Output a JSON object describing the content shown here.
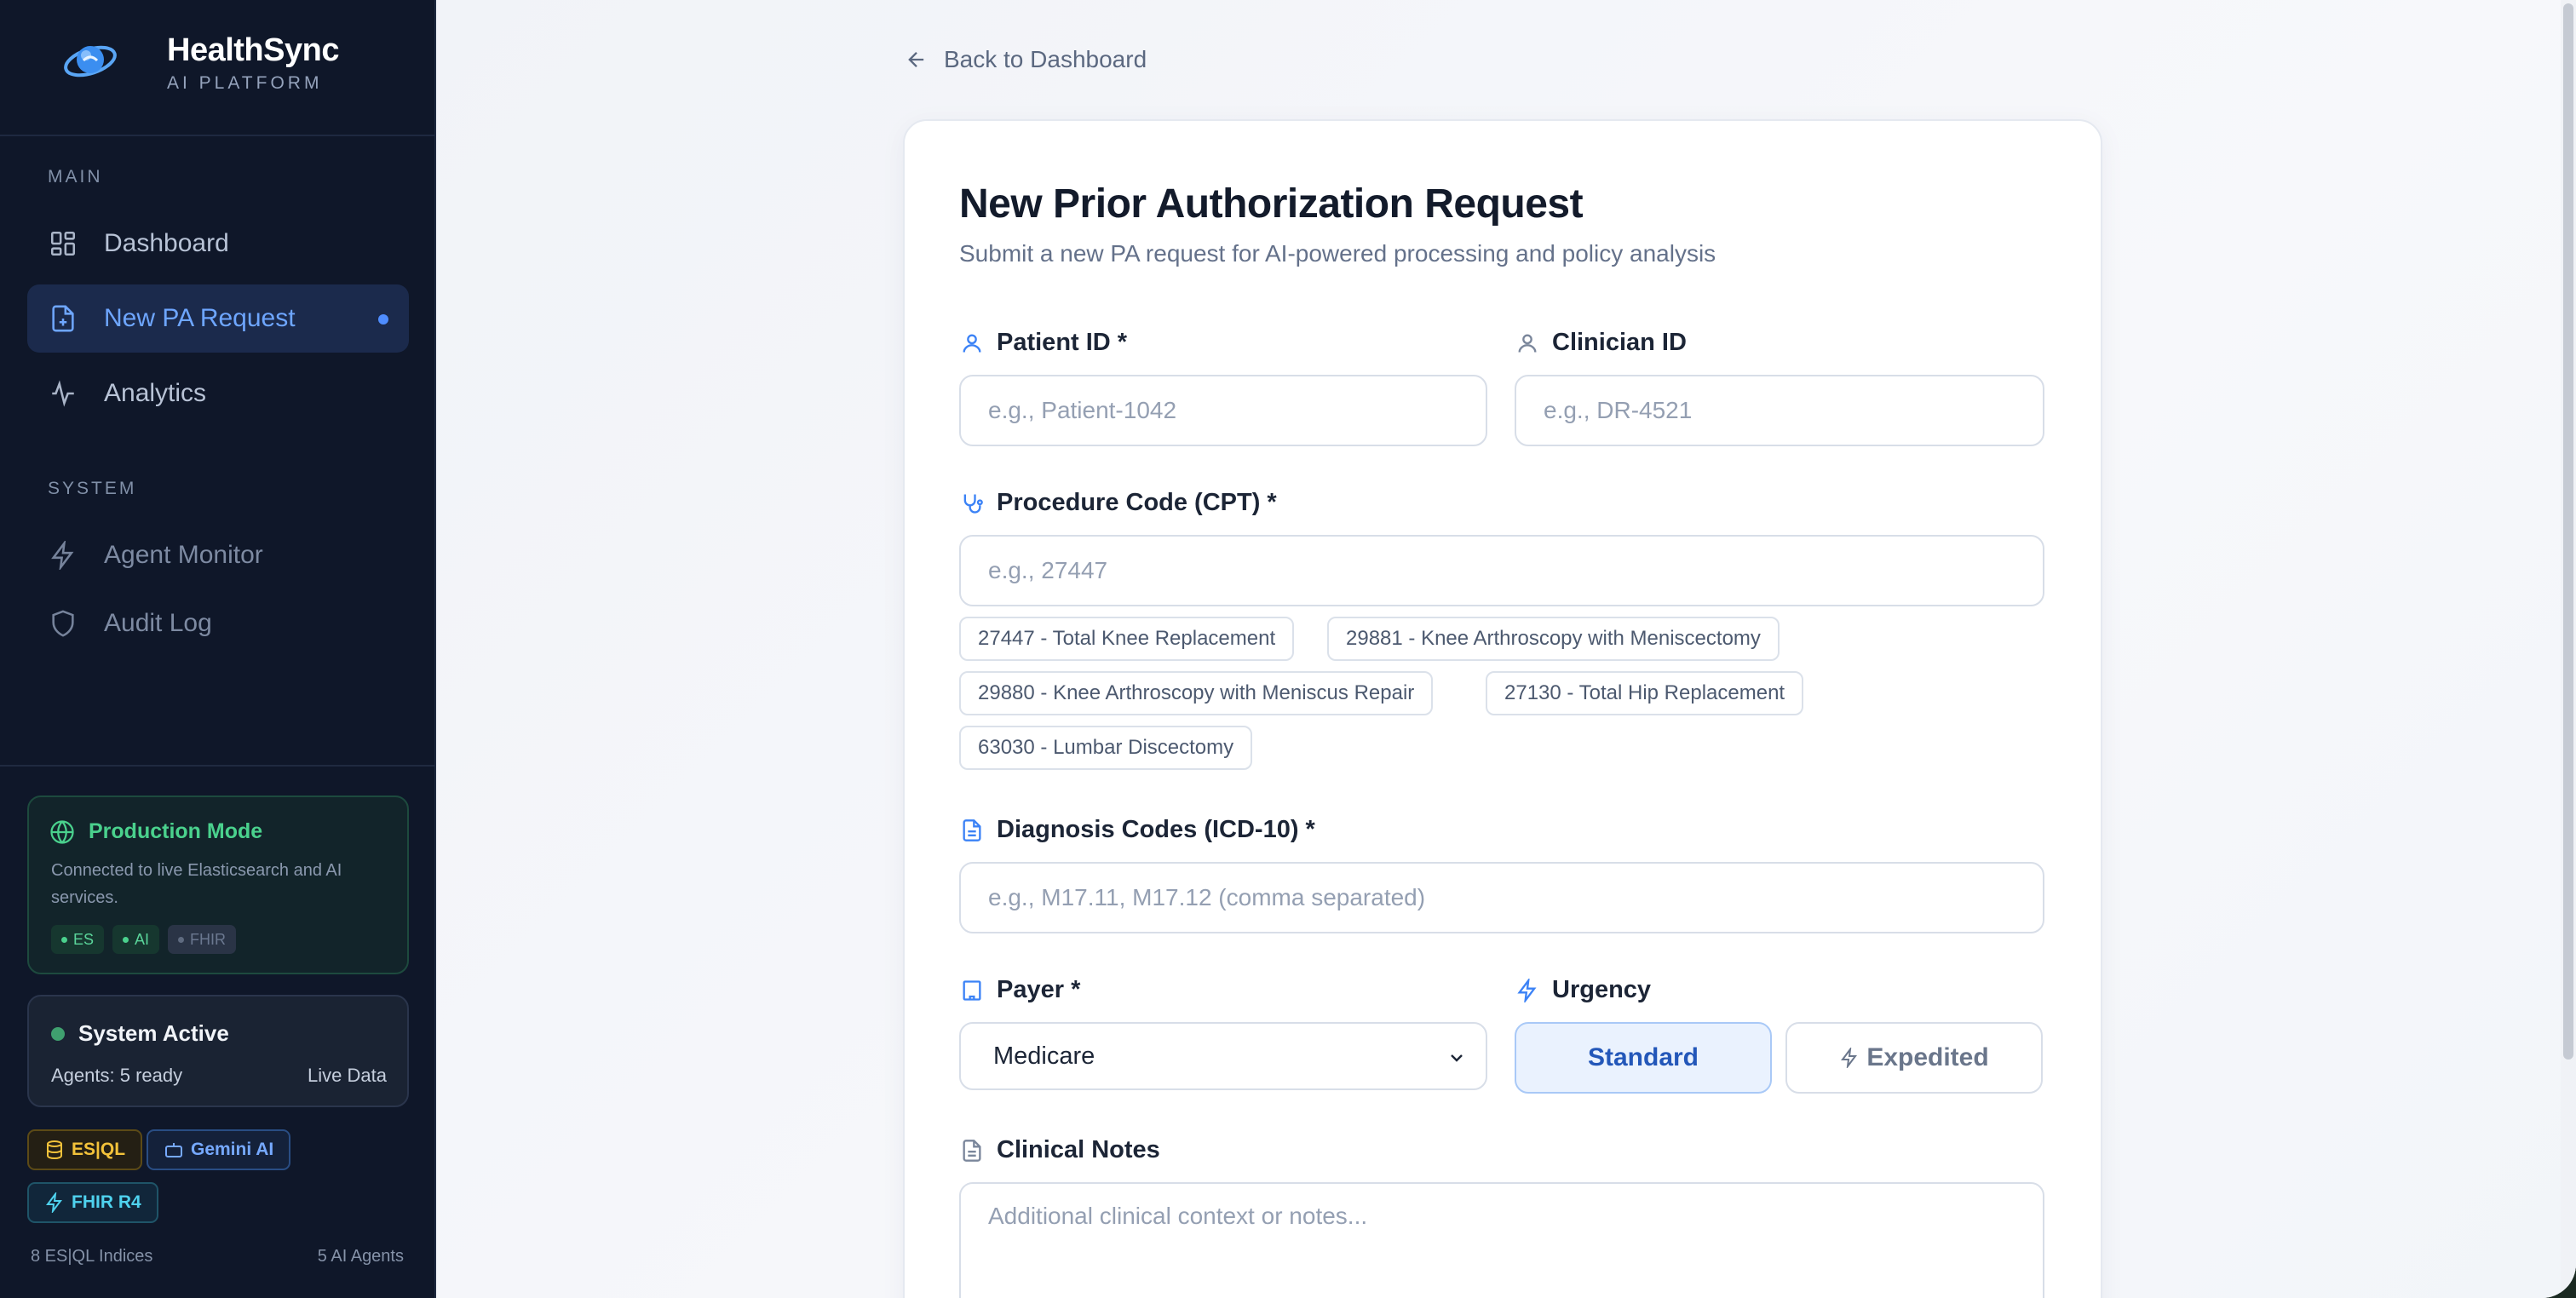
{
  "brand": {
    "name": "HealthSync",
    "subtitle": "AI PLATFORM"
  },
  "sidebar": {
    "section_main": "MAIN",
    "section_system": "SYSTEM",
    "main_items": [
      {
        "label": "Dashboard",
        "icon": "dashboard-grid-icon",
        "active": false
      },
      {
        "label": "New PA Request",
        "icon": "file-plus-icon",
        "active": true
      },
      {
        "label": "Analytics",
        "icon": "activity-icon",
        "active": false
      }
    ],
    "system_items": [
      {
        "label": "Agent Monitor",
        "icon": "lightning-icon"
      },
      {
        "label": "Audit Log",
        "icon": "shield-icon"
      }
    ],
    "production": {
      "title": "Production Mode",
      "description": "Connected to live Elasticsearch and AI services.",
      "pills": [
        "ES",
        "AI",
        "FHIR"
      ]
    },
    "system": {
      "title": "System Active",
      "agents": "Agents: 5 ready",
      "live": "Live Data"
    },
    "tags": [
      "ES|QL",
      "Gemini AI",
      "FHIR R4"
    ],
    "footer_left": "8 ES|QL Indices",
    "footer_right": "5 AI Agents"
  },
  "main": {
    "back_label": "Back to Dashboard",
    "title": "New Prior Authorization Request",
    "subtitle": "Submit a new PA request for AI-powered processing and policy analysis",
    "patient": {
      "label": "Patient ID *",
      "placeholder": "e.g., Patient-1042",
      "value": ""
    },
    "clinician": {
      "label": "Clinician ID",
      "placeholder": "e.g., DR-4521",
      "value": ""
    },
    "procedure": {
      "label": "Procedure Code (CPT) *",
      "placeholder": "e.g., 27447",
      "value": "",
      "suggestions": [
        "27447 - Total Knee Replacement",
        "29881 - Knee Arthroscopy with Meniscectomy",
        "29880 - Knee Arthroscopy with Meniscus Repair",
        "27130 - Total Hip Replacement",
        "63030 - Lumbar Discectomy"
      ]
    },
    "diagnosis": {
      "label": "Diagnosis Codes (ICD-10) *",
      "placeholder": "e.g., M17.11, M17.12 (comma separated)",
      "value": ""
    },
    "payer": {
      "label": "Payer *",
      "selected": "Medicare"
    },
    "urgency": {
      "label": "Urgency",
      "options": [
        "Standard",
        "Expedited"
      ],
      "selected": "Standard"
    },
    "notes": {
      "label": "Clinical Notes",
      "placeholder": "Additional clinical context or notes...",
      "value": ""
    }
  },
  "colors": {
    "sidebar_bg": "#0f1729",
    "accent_blue": "#4f8dff",
    "success_green": "#4ad18d",
    "card_bg": "#ffffff"
  }
}
